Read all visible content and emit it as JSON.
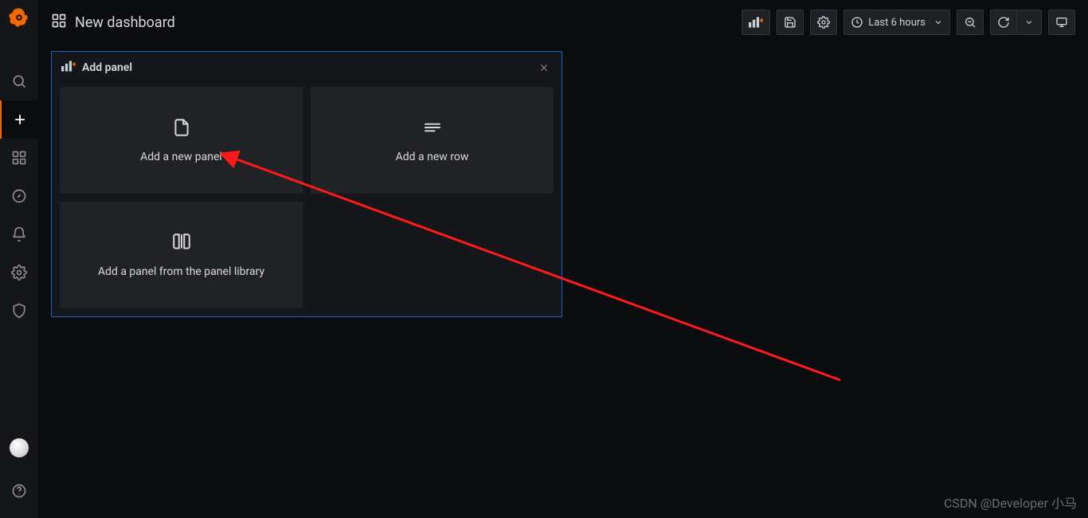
{
  "header": {
    "title": "New dashboard",
    "time_range": "Last 6 hours"
  },
  "add_panel": {
    "title": "Add panel",
    "cards": {
      "new_panel": "Add a new panel",
      "new_row": "Add a new row",
      "from_library": "Add a panel from the panel library"
    }
  },
  "watermark": "CSDN @Developer 小马"
}
